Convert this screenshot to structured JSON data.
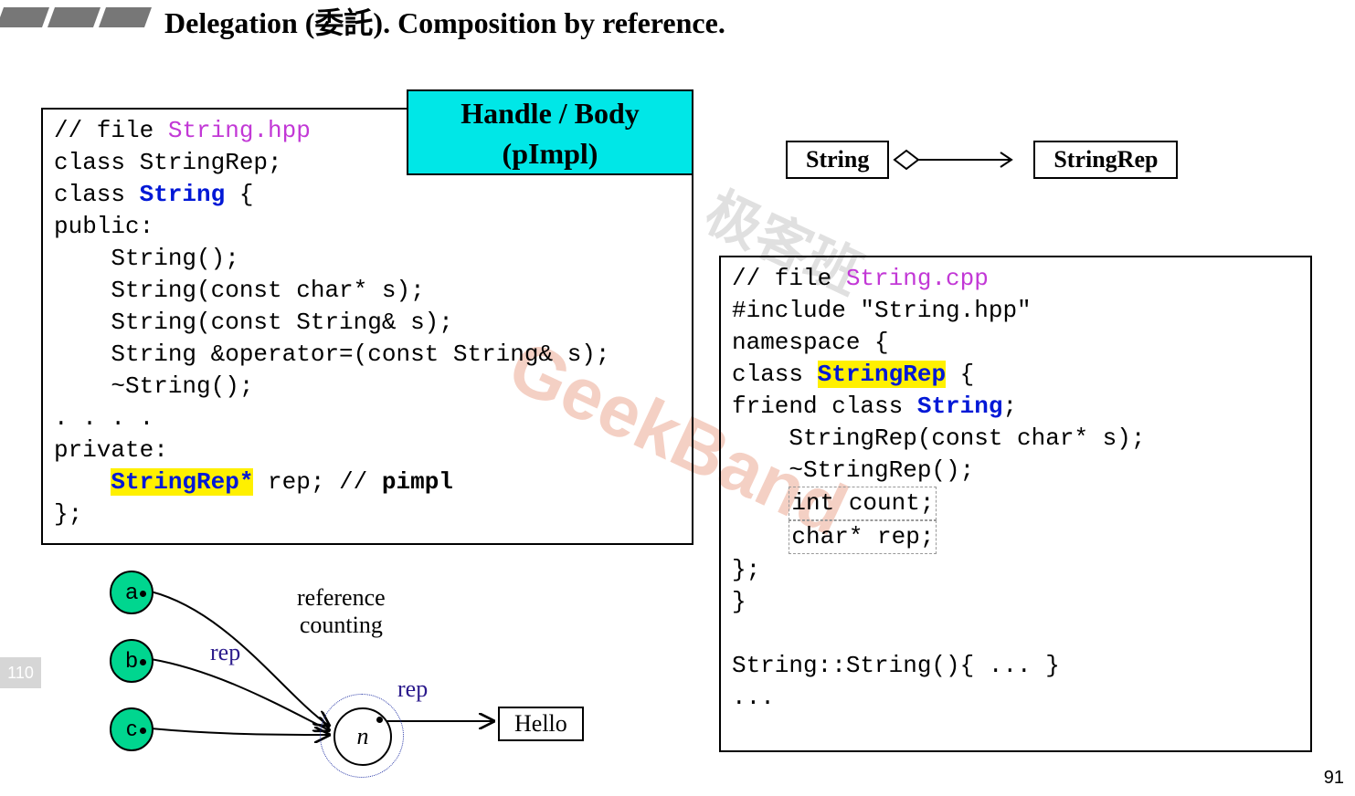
{
  "title": "Delegation (委託). Composition by reference.",
  "handle_body": {
    "line1": "Handle / Body",
    "line2": "(pImpl)"
  },
  "uml": {
    "left": "String",
    "right": "StringRep"
  },
  "code_left": {
    "file": "String.hpp",
    "comment_prefix": "// file ",
    "fwd": "class StringRep;",
    "class_kw": "class ",
    "class_name": "String",
    "brace": " {",
    "public": "public:",
    "ctor0": "    String();",
    "ctor1": "    String(const char* s);",
    "ctor2": "    String(const String& s);",
    "assign": "    String &operator=(const String& s);",
    "dtor": "    ~String();",
    "dots": ". . . .",
    "private": "private:",
    "member_type": "StringRep*",
    "member_rest": " rep; // ",
    "pimpl": "pimpl",
    "close": "};"
  },
  "code_right": {
    "file": "String.cpp",
    "comment_prefix": "// file ",
    "include": "#include \"String.hpp\"",
    "ns": "namespace {",
    "class_kw": "class ",
    "class_name": "StringRep",
    "brace": " {",
    "friend_pre": "friend class ",
    "friend_name": "String",
    "friend_post": ";",
    "ctor": "    StringRep(const char* s);",
    "dtor": "    ~StringRep();",
    "count": "int count;",
    "rep": "char* rep;",
    "close1": "};",
    "close2": "}",
    "impl": "String::String(){ ... }",
    "dots": "..."
  },
  "refcount": {
    "a": "a",
    "b": "b",
    "c": "c",
    "n": "n",
    "rep1": "rep",
    "rep2": "rep",
    "label": "reference\ncounting",
    "hello": "Hello"
  },
  "side_badge": "110",
  "page_num": "91",
  "watermark": "GeekBand",
  "watermark2": "极客班"
}
